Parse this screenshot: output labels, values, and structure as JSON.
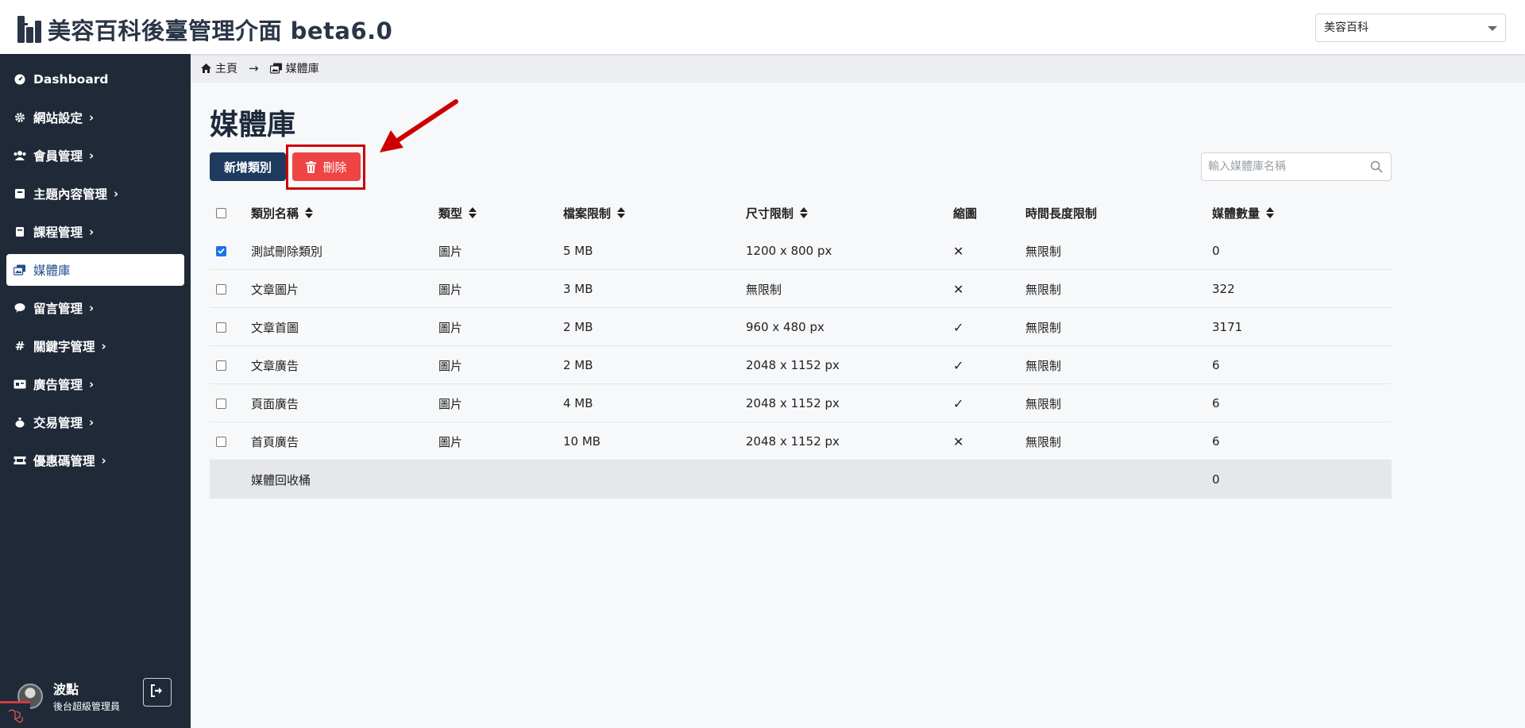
{
  "header": {
    "title": "美容百科後臺管理介面 beta6.0",
    "site_select": "美容百科"
  },
  "sidebar": {
    "items": [
      {
        "label": "Dashboard",
        "icon": "dashboard-icon",
        "expandable": false
      },
      {
        "label": "網站設定",
        "icon": "gear-icon",
        "expandable": true
      },
      {
        "label": "會員管理",
        "icon": "users-icon",
        "expandable": true
      },
      {
        "label": "主題內容管理",
        "icon": "book-icon",
        "expandable": true
      },
      {
        "label": "課程管理",
        "icon": "book-icon",
        "expandable": true
      },
      {
        "label": "媒體庫",
        "icon": "images-icon",
        "expandable": false,
        "active": true
      },
      {
        "label": "留言管理",
        "icon": "comment-icon",
        "expandable": true
      },
      {
        "label": "關鍵字管理",
        "icon": "hash-icon",
        "expandable": true
      },
      {
        "label": "廣告管理",
        "icon": "ad-icon",
        "expandable": true
      },
      {
        "label": "交易管理",
        "icon": "money-bag-icon",
        "expandable": true
      },
      {
        "label": "優惠碼管理",
        "icon": "ticket-icon",
        "expandable": true
      }
    ],
    "user": {
      "name": "波點",
      "role": "後台超級管理員"
    }
  },
  "breadcrumb": {
    "home": "主頁",
    "current": "媒體庫"
  },
  "page": {
    "title": "媒體庫",
    "add_button": "新增類別",
    "delete_button": "刪除",
    "search_placeholder": "輸入媒體庫名稱"
  },
  "table": {
    "columns": [
      "類別名稱",
      "類型",
      "檔案限制",
      "尺寸限制",
      "縮圖",
      "時間長度限制",
      "媒體數量"
    ],
    "rows": [
      {
        "checked": true,
        "name": "測試刪除類別",
        "type": "圖片",
        "file_limit": "5 MB",
        "size_limit": "1200 x 800 px",
        "thumbnail": false,
        "duration": "無限制",
        "count": "0"
      },
      {
        "checked": false,
        "name": "文章圖片",
        "type": "圖片",
        "file_limit": "3 MB",
        "size_limit": "無限制",
        "thumbnail": false,
        "duration": "無限制",
        "count": "322"
      },
      {
        "checked": false,
        "name": "文章首圖",
        "type": "圖片",
        "file_limit": "2 MB",
        "size_limit": "960 x 480 px",
        "thumbnail": true,
        "duration": "無限制",
        "count": "3171"
      },
      {
        "checked": false,
        "name": "文章廣告",
        "type": "圖片",
        "file_limit": "2 MB",
        "size_limit": "2048 x 1152 px",
        "thumbnail": true,
        "duration": "無限制",
        "count": "6"
      },
      {
        "checked": false,
        "name": "頁面廣告",
        "type": "圖片",
        "file_limit": "4 MB",
        "size_limit": "2048 x 1152 px",
        "thumbnail": true,
        "duration": "無限制",
        "count": "6"
      },
      {
        "checked": false,
        "name": "首頁廣告",
        "type": "圖片",
        "file_limit": "10 MB",
        "size_limit": "2048 x 1152 px",
        "thumbnail": false,
        "duration": "無限制",
        "count": "6"
      }
    ],
    "trash": {
      "name": "媒體回收桶",
      "count": "0"
    }
  },
  "symbols": {
    "yes": "✓",
    "no": "✕"
  },
  "colors": {
    "sidebar_bg": "#1f2937",
    "primary": "#1e3a5f",
    "danger": "#ef4444",
    "annotation": "#cc0000"
  }
}
